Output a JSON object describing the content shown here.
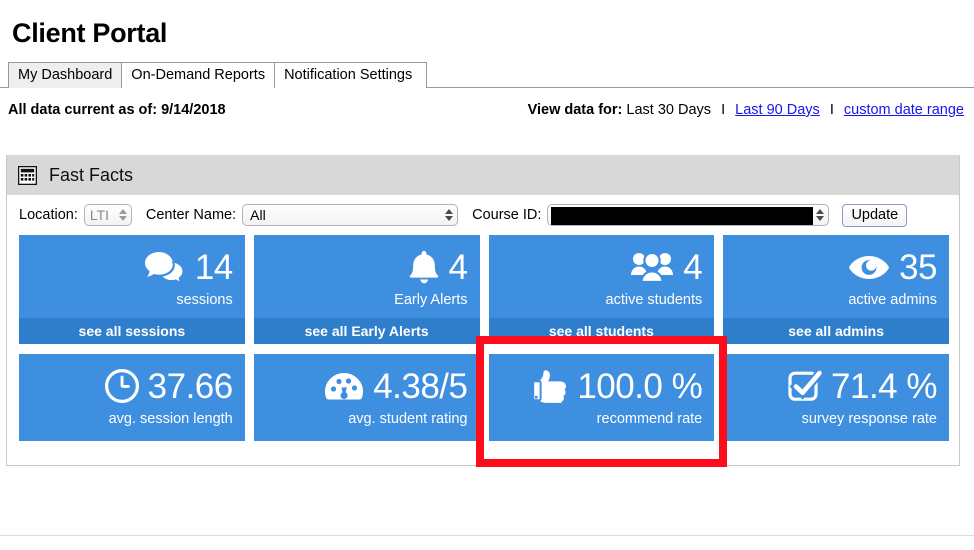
{
  "header": {
    "title": "Client Portal"
  },
  "tabs": [
    {
      "label": "My Dashboard",
      "active": true
    },
    {
      "label": "On-Demand Reports",
      "active": false
    },
    {
      "label": "Notification Settings",
      "active": false
    }
  ],
  "meta": {
    "current_as_of": "All data current as of: 9/14/2018",
    "view_data_for_label": "View data for:",
    "range_current": "Last 30 Days",
    "separator": "I",
    "range_link_1": "Last 90 Days",
    "range_link_2": "custom date range",
    "link_color": "#1515ee"
  },
  "panel": {
    "icon": "grid-icon",
    "title": "Fast Facts",
    "header_bg": "#d8d8d8"
  },
  "filters": {
    "location_label": "Location:",
    "location_value": "LTI",
    "center_label": "Center Name:",
    "center_value": "All",
    "course_label": "Course ID:",
    "course_value": "",
    "course_redacted": true,
    "update_label": "Update"
  },
  "tiles": {
    "accent": "#3f8fe0",
    "footer_accent": "#2f7ecb",
    "highlight_color": "#fc0d1b",
    "row1": [
      {
        "icon": "speech-bubbles-icon",
        "value": "14",
        "label": "sessions",
        "footer": "see all sessions"
      },
      {
        "icon": "bell-icon",
        "value": "4",
        "label": "Early Alerts",
        "footer": "see all Early Alerts"
      },
      {
        "icon": "people-group-icon",
        "value": "4",
        "label": "active students",
        "footer": "see all students"
      },
      {
        "icon": "eye-icon",
        "value": "35",
        "label": "active admins",
        "footer": "see all admins"
      }
    ],
    "row2": [
      {
        "icon": "clock-icon",
        "value": "37.66",
        "label": "avg. session length",
        "highlighted": false
      },
      {
        "icon": "gauge-icon",
        "value": "4.38/5",
        "label": "avg. student rating",
        "highlighted": false
      },
      {
        "icon": "thumbs-up-icon",
        "value": "100.0 %",
        "label": "recommend rate",
        "highlighted": true
      },
      {
        "icon": "checkbox-checked-icon",
        "value": "71.4 %",
        "label": "survey response rate",
        "highlighted": false
      }
    ]
  }
}
